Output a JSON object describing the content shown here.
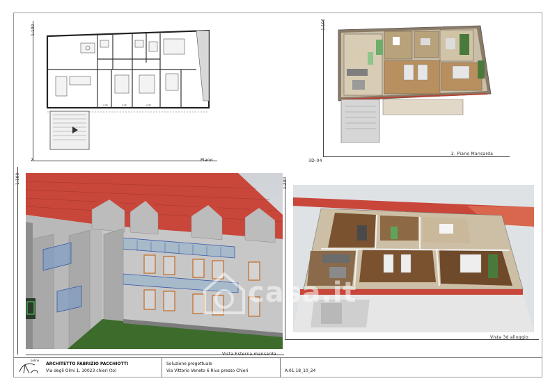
{
  "plan_2d": {
    "scale": "1:100",
    "number": "2.",
    "caption": "Piano"
  },
  "plan_3d_top": {
    "scale": "1:100",
    "number": "3D-04",
    "caption": "2. Piano Mansarda"
  },
  "external_view": {
    "scale": "1:100",
    "caption": "Vista Esterna mansarda"
  },
  "view_3d": {
    "scale": "1:200",
    "caption": "Vista 3d alloggio"
  },
  "watermark": {
    "text": "casa.it"
  },
  "title_block": {
    "logo_small_text": "online",
    "architect": "ARCHITETTO FABRIZIO PACCHIOTTI",
    "address": "Via degli Olmi 1, 10023 chieri (to)",
    "project_title": "Soluzione progettuale",
    "project_address": "Via Vittorio Veneto 6 Riva presso Chieri",
    "drawing_code": "A.01.18_10_24"
  },
  "colors": {
    "roof": "#c9463a",
    "wall": "#bdbdbd",
    "grass": "#3d6b2c",
    "floor_wood": "#7a5230",
    "glass": "#9fc6dc",
    "railing_blue": "#3b57a8"
  }
}
